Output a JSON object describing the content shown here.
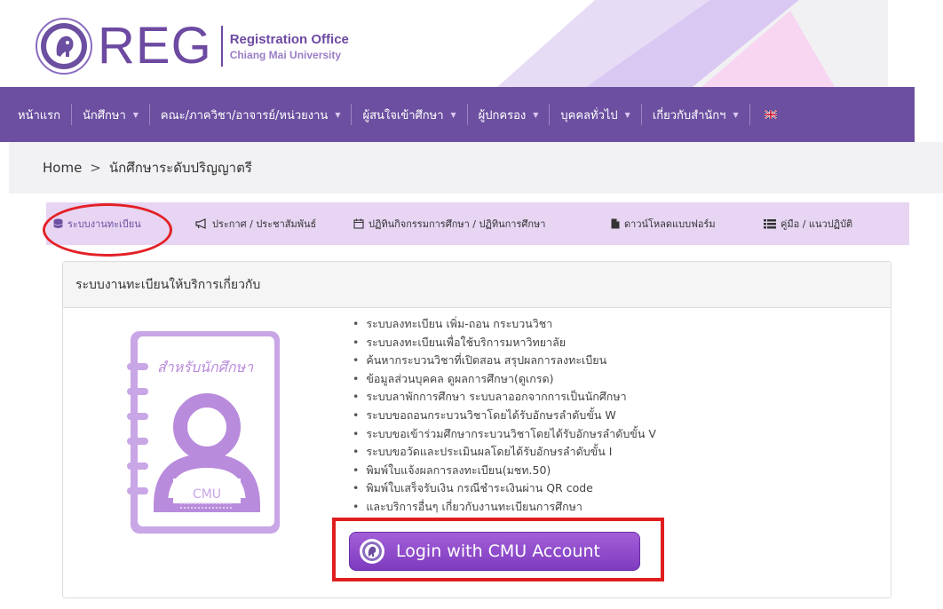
{
  "header": {
    "logo_text": "REG",
    "org_line1": "Registration Office",
    "org_line2": "Chiang Mai University"
  },
  "nav": {
    "items": [
      {
        "label": "หน้าแรก"
      },
      {
        "label": "นักศึกษา"
      },
      {
        "label": "คณะ/ภาควิชา/อาจารย์/หน่วยงาน"
      },
      {
        "label": "ผู้สนใจเข้าศึกษา"
      },
      {
        "label": "ผู้ปกครอง"
      },
      {
        "label": "บุคคลทั่วไป"
      },
      {
        "label": "เกี่ยวกับสำนักฯ"
      }
    ]
  },
  "breadcrumb": {
    "home": "Home",
    "separator": ">",
    "current": "นักศึกษาระดับปริญญาตรี"
  },
  "tabs": [
    {
      "label": "ระบบงานทะเบียน",
      "icon": "database-icon"
    },
    {
      "label": "ประกาศ / ประชาสัมพันธ์",
      "icon": "megaphone-icon"
    },
    {
      "label": "ปฏิทินกิจกรรมการศึกษา / ปฏิทินการศึกษา",
      "icon": "calendar-icon"
    },
    {
      "label": "ดาวน์โหลดแบบฟอร์ม",
      "icon": "file-icon"
    },
    {
      "label": "คู่มือ / แนวปฏิบัติ",
      "icon": "list-icon"
    }
  ],
  "panel": {
    "title": "ระบบงานทะเบียนให้บริการเกี่ยวกับ",
    "illustration_text": "สำหรับนักศึกษา",
    "illustration_badge": "CMU",
    "services": [
      "ระบบลงทะเบียน เพิ่ม-ถอน กระบวนวิชา",
      "ระบบลงทะเบียนเพื่อใช้บริการมหาวิทยาลัย",
      "ค้นหากระบวนวิชาที่เปิดสอน สรุปผลการลงทะเบียน",
      "ข้อมูลส่วนบุคคล ดูผลการศึกษา(ดูเกรด)",
      "ระบบลาพักการศึกษา ระบบลาออกจากการเป็นนักศึกษา",
      "ระบบขอถอนกระบวนวิชาโดยได้รับอักษรลำดับขั้น W",
      "ระบบขอเข้าร่วมศึกษากระบวนวิชาโดยได้รับอักษรลำดับขั้น V",
      "ระบบขอวัดและประเมินผลโดยได้รับอักษรลำดับขั้น I",
      "พิมพ์ใบแจ้งผลการลงทะเบียน(มชท.50)",
      "พิมพ์ใบเสร็จรับเงิน กรณีชำระเงินผ่าน QR code",
      "และบริการอื่นๆ เกี่ยวกับงานทะเบียนการศึกษา"
    ],
    "login_label": "Login with CMU Account"
  },
  "colors": {
    "brand": "#6c4fa0",
    "tab_bg": "#e7d5f3",
    "highlight": "#e01e1e"
  }
}
